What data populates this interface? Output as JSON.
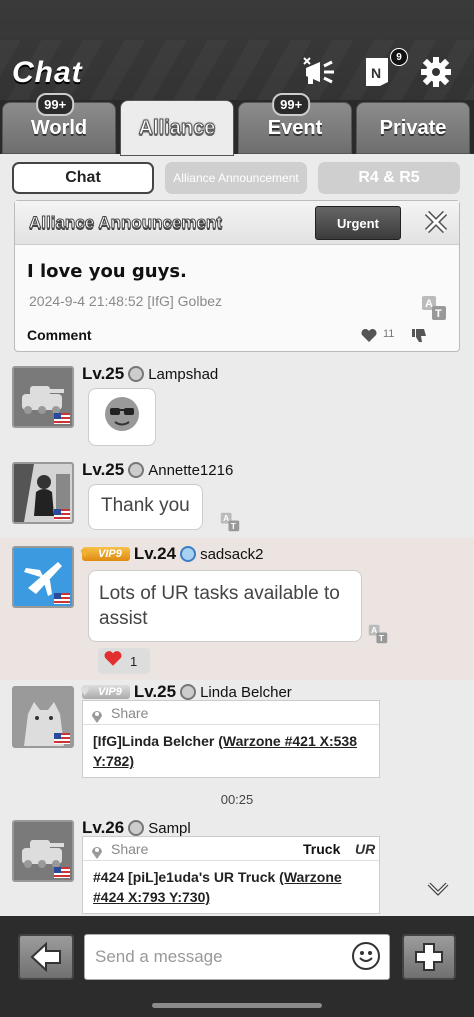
{
  "header": {
    "title": "Chat",
    "mail_badge": "9"
  },
  "tabs": [
    {
      "label": "World",
      "badge": "99+"
    },
    {
      "label": "Alliance",
      "badge": ""
    },
    {
      "label": "Event",
      "badge": "99+"
    },
    {
      "label": "Private",
      "badge": ""
    }
  ],
  "subtabs": [
    {
      "label": "Chat"
    },
    {
      "label": "Alliance Announcement"
    },
    {
      "label": "R4 & R5"
    }
  ],
  "announcement": {
    "title": "Alliance Announcement",
    "urgent_label": "Urgent",
    "text": "I love you guys.",
    "meta": "2024-9-4 21:48:52 [IfG] Golbez",
    "comment_label": "Comment",
    "likes": "11"
  },
  "messages": [
    {
      "level": "Lv.25",
      "name": "Lampshad",
      "content": ""
    },
    {
      "level": "Lv.25",
      "name": "Annette1216",
      "content": "Thank you"
    },
    {
      "vip": "VIP9",
      "level": "Lv.24",
      "name": "sadsack2",
      "content": "Lots of UR tasks available to assist",
      "reaction_count": "1"
    },
    {
      "vip": "VIP9",
      "level": "Lv.25",
      "name": "Linda Belcher",
      "share_label": "Share",
      "share_prefix": "[IfG]Linda Belcher ",
      "share_link": "(Warzone #421 X:538 Y:782)"
    },
    {
      "level": "Lv.26",
      "name": "Sampl",
      "share_label": "Share",
      "share_tag": "Truck",
      "share_grade": "UR",
      "share_prefix": "#424 [piL]e1uda's UR Truck ",
      "share_link": "(Warzone #424 X:793  Y:730)"
    }
  ],
  "time_separator": "00:25",
  "composer": {
    "placeholder": "Send a message"
  }
}
